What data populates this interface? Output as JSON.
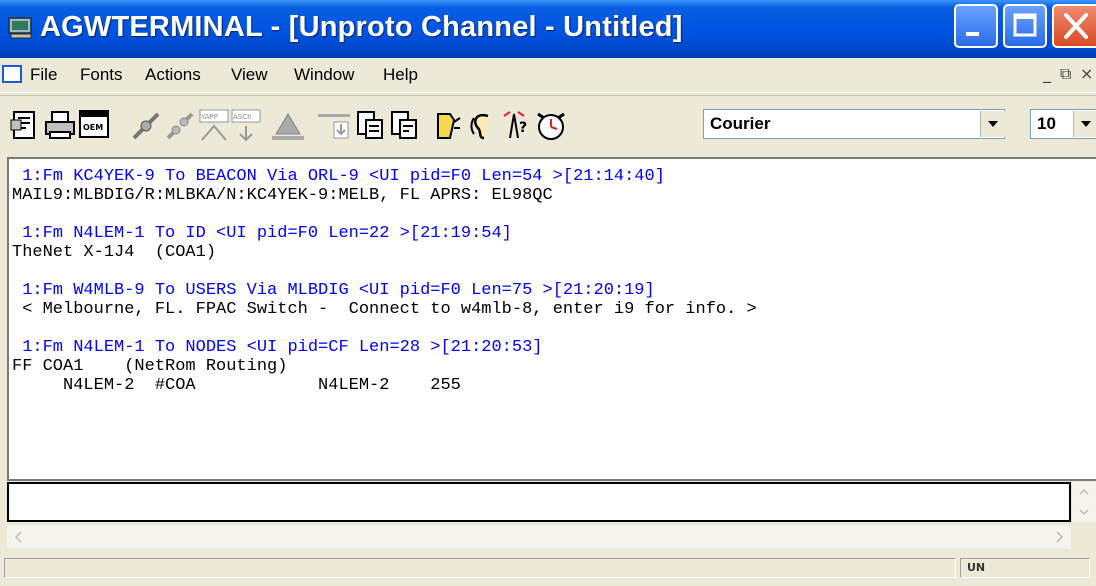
{
  "window": {
    "title": "AGWTERMINAL - [Unproto Channel - Untitled]",
    "accent": "#0054e3",
    "close_color": "#d84a22"
  },
  "menu": {
    "items": [
      "File",
      "Fonts",
      "Actions",
      "View",
      "Window",
      "Help"
    ],
    "mdi_controls": [
      "_",
      "⧉",
      "×"
    ]
  },
  "toolbar": {
    "icons": [
      "properties-icon",
      "print-icon",
      "oem-icon",
      "connect-icon",
      "disconnect-icon",
      "yapp-icon",
      "ascii-icon",
      "upload-icon",
      "download-icon",
      "copy-icon",
      "paste-icon",
      "beacon-icon",
      "listen-icon",
      "help-icon",
      "clock-icon"
    ],
    "yapp_label": "YAPP",
    "ascii_label": "ASCII",
    "oem_label": "OEM",
    "font_name": "Courier",
    "font_size": "10"
  },
  "output": {
    "header_color": "#0000ff",
    "lines": [
      {
        "type": "hdr",
        "text": " 1:Fm KC4YEK-9 To BEACON Via ORL-9 <UI pid=F0 Len=54 >[21:14:40]"
      },
      {
        "type": "body",
        "text": "MAIL9:MLBDIG/R:MLBKA/N:KC4YEK-9:MELB, FL APRS: EL98QC"
      },
      {
        "type": "gap",
        "text": ""
      },
      {
        "type": "hdr",
        "text": " 1:Fm N4LEM-1 To ID <UI pid=F0 Len=22 >[21:19:54]"
      },
      {
        "type": "body",
        "text": "TheNet X-1J4  (COA1)"
      },
      {
        "type": "gap",
        "text": ""
      },
      {
        "type": "hdr",
        "text": " 1:Fm W4MLB-9 To USERS Via MLBDIG <UI pid=F0 Len=75 >[21:20:19]"
      },
      {
        "type": "body",
        "text": " < Melbourne, FL. FPAC Switch -  Connect to w4mlb-8, enter i9 for info. >"
      },
      {
        "type": "gap",
        "text": ""
      },
      {
        "type": "hdr",
        "text": " 1:Fm N4LEM-1 To NODES <UI pid=CF Len=28 >[21:20:53]"
      },
      {
        "type": "body",
        "text": "FF COA1    (NetRom Routing)"
      },
      {
        "type": "body",
        "text": "     N4LEM-2  #COA            N4LEM-2    255"
      }
    ]
  },
  "status": {
    "mode": "UN"
  }
}
